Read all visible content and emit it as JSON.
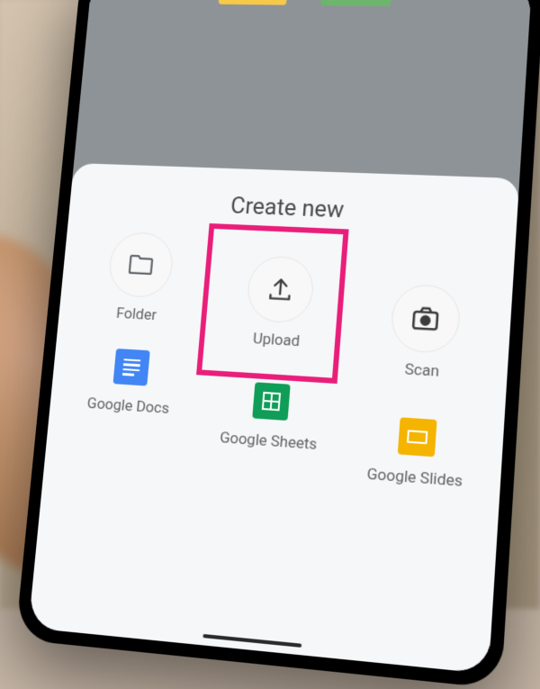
{
  "sheet": {
    "title": "Create new",
    "options": [
      {
        "label": "Folder"
      },
      {
        "label": "Upload"
      },
      {
        "label": "Scan"
      },
      {
        "label": "Google Docs"
      },
      {
        "label": "Google Sheets"
      },
      {
        "label": "Google Slides"
      }
    ]
  },
  "highlight": {
    "target": "upload"
  }
}
